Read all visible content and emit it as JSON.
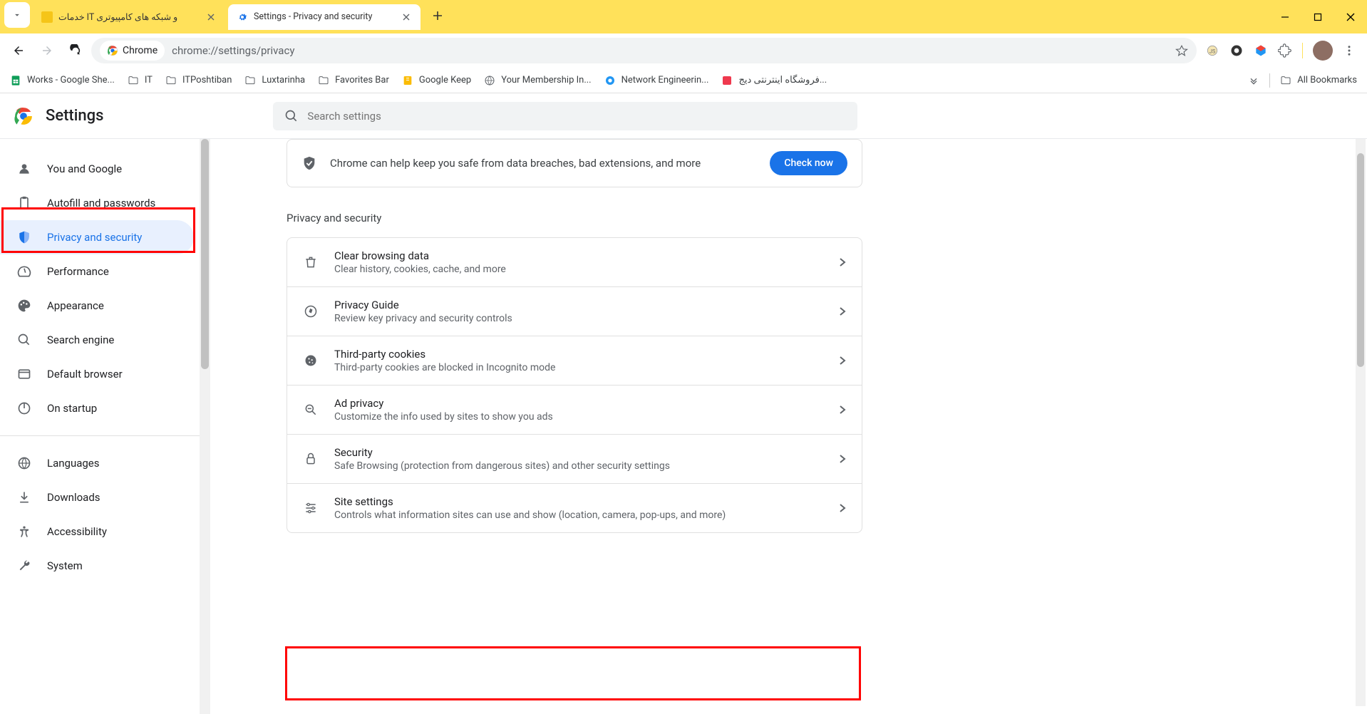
{
  "tabs": [
    {
      "title": "خدمات IT و شبکه های کامپیوتری",
      "active": false
    },
    {
      "title": "Settings - Privacy and security",
      "active": true
    }
  ],
  "omnibox": {
    "chip_label": "Chrome",
    "url": "chrome://settings/privacy"
  },
  "bookmarks": [
    {
      "label": "Works - Google She...",
      "icon": "sheets"
    },
    {
      "label": "IT",
      "icon": "folder"
    },
    {
      "label": "ITPoshtiban",
      "icon": "folder"
    },
    {
      "label": "Luxtarinha",
      "icon": "folder"
    },
    {
      "label": "Favorites Bar",
      "icon": "folder"
    },
    {
      "label": "Google Keep",
      "icon": "keep"
    },
    {
      "label": "Your Membership In...",
      "icon": "globe"
    },
    {
      "label": "Network Engineerin...",
      "icon": "ne"
    },
    {
      "label": "فروشگاه اینترنتی دیج...",
      "icon": "digi"
    }
  ],
  "bookmarks_right": {
    "all": "All Bookmarks"
  },
  "header": {
    "title": "Settings",
    "search_placeholder": "Search settings"
  },
  "sidebar": {
    "items_a": [
      {
        "label": "You and Google",
        "icon": "person"
      },
      {
        "label": "Autofill and passwords",
        "icon": "clipboard"
      },
      {
        "label": "Privacy and security",
        "icon": "shield",
        "active": true
      },
      {
        "label": "Performance",
        "icon": "speed"
      },
      {
        "label": "Appearance",
        "icon": "palette"
      },
      {
        "label": "Search engine",
        "icon": "search"
      },
      {
        "label": "Default browser",
        "icon": "browser"
      },
      {
        "label": "On startup",
        "icon": "power"
      }
    ],
    "items_b": [
      {
        "label": "Languages",
        "icon": "globe"
      },
      {
        "label": "Downloads",
        "icon": "download"
      },
      {
        "label": "Accessibility",
        "icon": "accessibility"
      },
      {
        "label": "System",
        "icon": "wrench"
      }
    ]
  },
  "main": {
    "safety_text": "Chrome can help keep you safe from data breaches, bad extensions, and more",
    "safety_button": "Check now",
    "section": "Privacy and security",
    "rows": [
      {
        "icon": "trash",
        "title": "Clear browsing data",
        "sub": "Clear history, cookies, cache, and more"
      },
      {
        "icon": "compass",
        "title": "Privacy Guide",
        "sub": "Review key privacy and security controls"
      },
      {
        "icon": "cookie",
        "title": "Third-party cookies",
        "sub": "Third-party cookies are blocked in Incognito mode"
      },
      {
        "icon": "adprivacy",
        "title": "Ad privacy",
        "sub": "Customize the info used by sites to show you ads"
      },
      {
        "icon": "lock",
        "title": "Security",
        "sub": "Safe Browsing (protection from dangerous sites) and other security settings"
      },
      {
        "icon": "sliders",
        "title": "Site settings",
        "sub": "Controls what information sites can use and show (location, camera, pop-ups, and more)"
      }
    ]
  }
}
